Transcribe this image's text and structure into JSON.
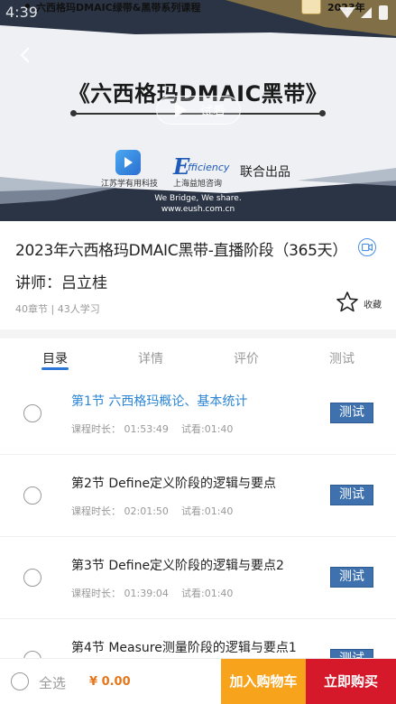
{
  "status_bar": {
    "time": "4:39",
    "marquee": "六西格玛DMAIC绿带&黑带系列课程",
    "year": "2023年"
  },
  "banner": {
    "title": "《六西格玛DMAIC黑带》",
    "preview_label": "试看",
    "partner1_name": "江苏学有用科技",
    "partner2_wordmark": "fficiency",
    "partner2_letter": "E",
    "partner2_name": "上海益旭咨询",
    "joint_label": "联合出品",
    "slogan": "We Bridge, We share.",
    "website": "www.eush.com.cn"
  },
  "course": {
    "title": "2023年六西格玛DMAIC黑带-直播阶段（365天）",
    "lecturer": "讲师：吕立桂",
    "meta": "40章节 | 43人学习",
    "favorite_label": "收藏"
  },
  "tabs": [
    {
      "label": "目录",
      "active": true
    },
    {
      "label": "详情",
      "active": false
    },
    {
      "label": "评价",
      "active": false
    },
    {
      "label": "测试",
      "active": false
    }
  ],
  "lessons": [
    {
      "title": "第1节 六西格玛概论、基本统计",
      "duration": "课程时长：  01:53:49",
      "trial": "试看:01:40",
      "test_label": "测试",
      "active": true
    },
    {
      "title": "第2节 Define定义阶段的逻辑与要点",
      "duration": "课程时长：  02:01:50",
      "trial": "试看:01:40",
      "test_label": "测试",
      "active": false
    },
    {
      "title": "第3节 Define定义阶段的逻辑与要点2",
      "duration": "课程时长：  01:39:04",
      "trial": "试看:01:40",
      "test_label": "测试",
      "active": false
    },
    {
      "title": "第4节 Measure测量阶段的逻辑与要点1",
      "duration": "",
      "trial": "",
      "test_label": "测试",
      "active": false
    }
  ],
  "bottom_bar": {
    "select_all": "全选",
    "total": "¥ 0.00",
    "cart_label": "加入购物车",
    "buy_label": "立即购买"
  },
  "colors": {
    "accent_blue": "#2b86d6",
    "test_button": "#3e71ae",
    "cart": "#f7a31c",
    "buy": "#d6192a",
    "price": "#e6761a"
  }
}
